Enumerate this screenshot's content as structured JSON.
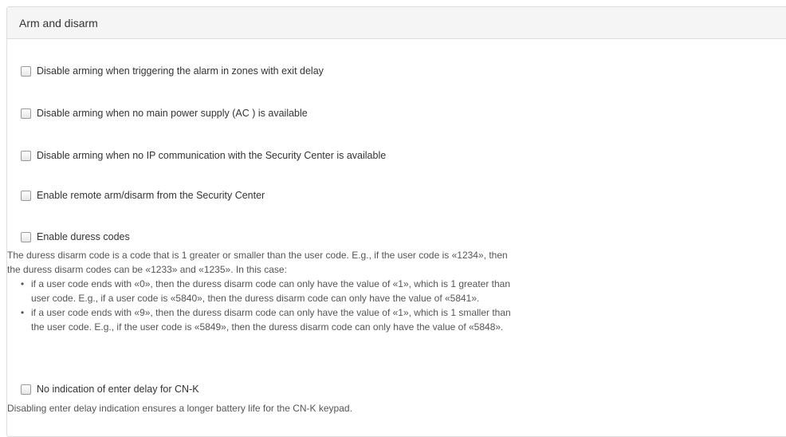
{
  "panel": {
    "title": "Arm and disarm"
  },
  "options": [
    {
      "label": "Disable arming when triggering the alarm in zones with exit delay",
      "checked": false
    },
    {
      "label": "Disable arming when no main power supply (AC ) is available",
      "checked": false
    },
    {
      "label": "Disable arming when no IP communication with the Security Center is available",
      "checked": false
    },
    {
      "label": "Enable remote arm/disarm from the Security Center",
      "checked": false
    },
    {
      "label": "Enable duress codes",
      "checked": false
    },
    {
      "label": "No indication of enter delay for CN-K",
      "checked": false
    }
  ],
  "duress_help": {
    "line1": "The duress disarm code is a code that is 1 greater or smaller than the user code. E.g., if the user code is «1234», then",
    "line2": "the duress disarm codes can be «1233» and «1235». In this case:",
    "bullet1": {
      "line1": "if a user code ends with «0», then the duress disarm code can only have the value of «1», which is 1 greater than",
      "line2": "user code. E.g., if a user code is «5840», then the duress disarm code can only have the value of «5841»."
    },
    "bullet2": {
      "line1": "if a user code ends with «9», then the duress disarm code can only have the value of «1», which is 1 smaller than",
      "line2": "the user code. E.g., if the user code is «5849», then the duress disarm code can only have the value of «5848»."
    }
  },
  "cnk_help": "Disabling enter delay indication ensures a longer battery life for the CN-K keypad."
}
